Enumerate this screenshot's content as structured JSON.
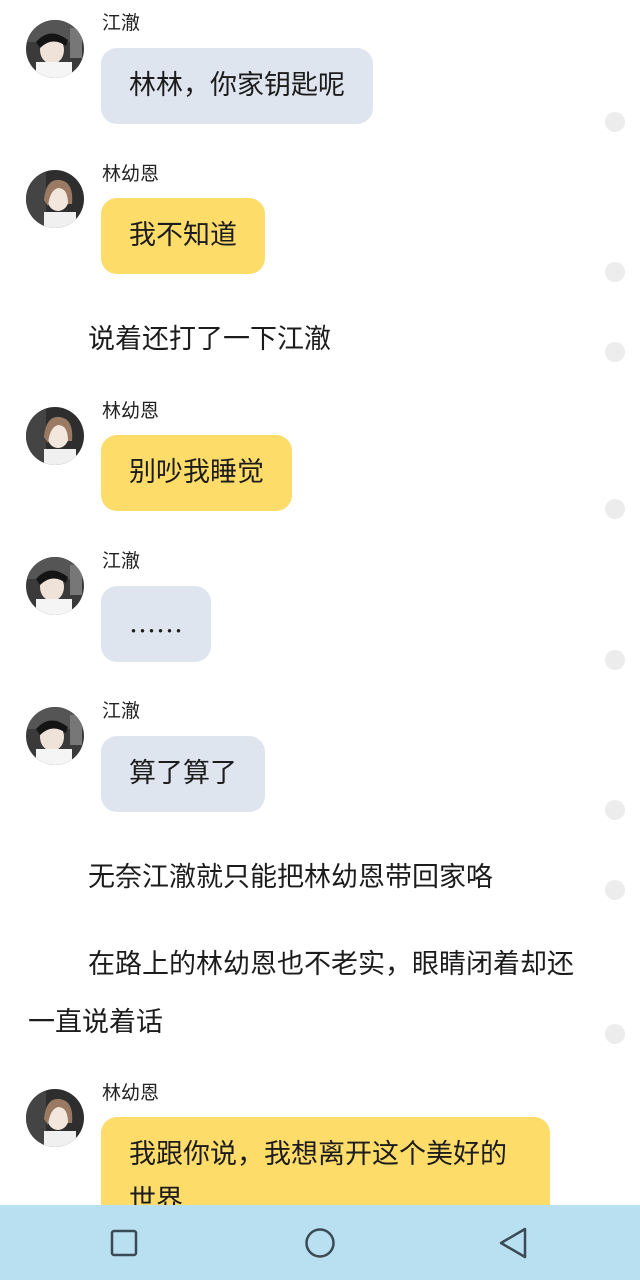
{
  "messages": [
    {
      "sender": "江澈",
      "text": "林林，你家钥匙呢",
      "side": "left",
      "color": "blue"
    },
    {
      "sender": "林幼恩",
      "text": "我不知道",
      "side": "left",
      "color": "yellow"
    },
    {
      "sender": "林幼恩",
      "text": "别吵我睡觉",
      "side": "left",
      "color": "yellow"
    },
    {
      "sender": "江澈",
      "text": "……",
      "side": "left",
      "color": "blue"
    },
    {
      "sender": "江澈",
      "text": "算了算了",
      "side": "left",
      "color": "blue"
    },
    {
      "sender": "林幼恩",
      "text": "我跟你说，我想离开这个美好的世界",
      "side": "left",
      "color": "yellow"
    }
  ],
  "narration": [
    "说着还打了一下江澈",
    "无奈江澈就只能把林幼恩带回家咯",
    "在路上的林幼恩也不老实，眼睛闭着却还一直说着话"
  ],
  "colors": {
    "bubble_blue": "#dfe5ef",
    "bubble_yellow": "#fddc6a",
    "navbar": "#b9e0f1",
    "side_dot": "#ececec"
  },
  "navbar": {
    "buttons": [
      "recent-apps-icon",
      "home-icon",
      "back-icon"
    ]
  }
}
